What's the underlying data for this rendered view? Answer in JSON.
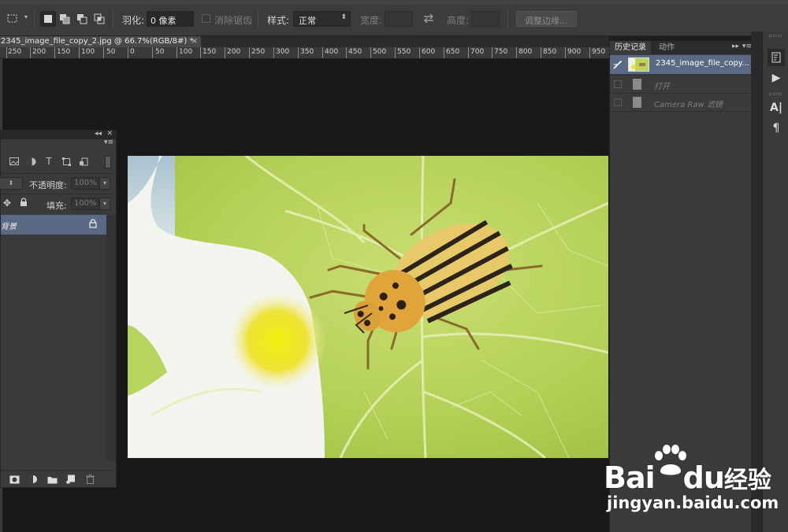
{
  "options_bar": {
    "feather_label": "羽化:",
    "feather_value": "0 像素",
    "antialias_label": "消除锯齿",
    "style_label": "样式:",
    "style_value": "正常",
    "width_label": "宽度:",
    "height_label": "高度:",
    "refine_edge_label": "调整边缘..."
  },
  "document_tab": {
    "title": "2345_image_file_copy_2.jpg @ 66.7%(RGB/8#) *",
    "close": "×"
  },
  "ruler": {
    "labels": [
      "250",
      "200",
      "150",
      "100",
      "50",
      "0",
      "50",
      "100",
      "150",
      "200",
      "250",
      "300",
      "350",
      "400",
      "450",
      "500",
      "550",
      "600",
      "650",
      "700",
      "750",
      "800",
      "850",
      "900",
      "950"
    ]
  },
  "layers_panel": {
    "opacity_label": "不透明度:",
    "opacity_value": "100%",
    "fill_label": "填充:",
    "fill_value": "100%",
    "layer_name": "背景"
  },
  "history_panel": {
    "tab_history": "历史记录",
    "tab_actions": "动作",
    "snapshot_name": "2345_image_file_copy...",
    "steps": [
      "打开",
      "Camera Raw 滤镜"
    ]
  },
  "watermark": {
    "brand_latin": "Bai",
    "brand_du": "du",
    "brand_cn": "经验",
    "url": "jingyan.baidu.com"
  },
  "colors": {
    "panel_bg": "#3a3a3a",
    "canvas_bg": "#191919",
    "selection_blue": "#5a6a84"
  }
}
